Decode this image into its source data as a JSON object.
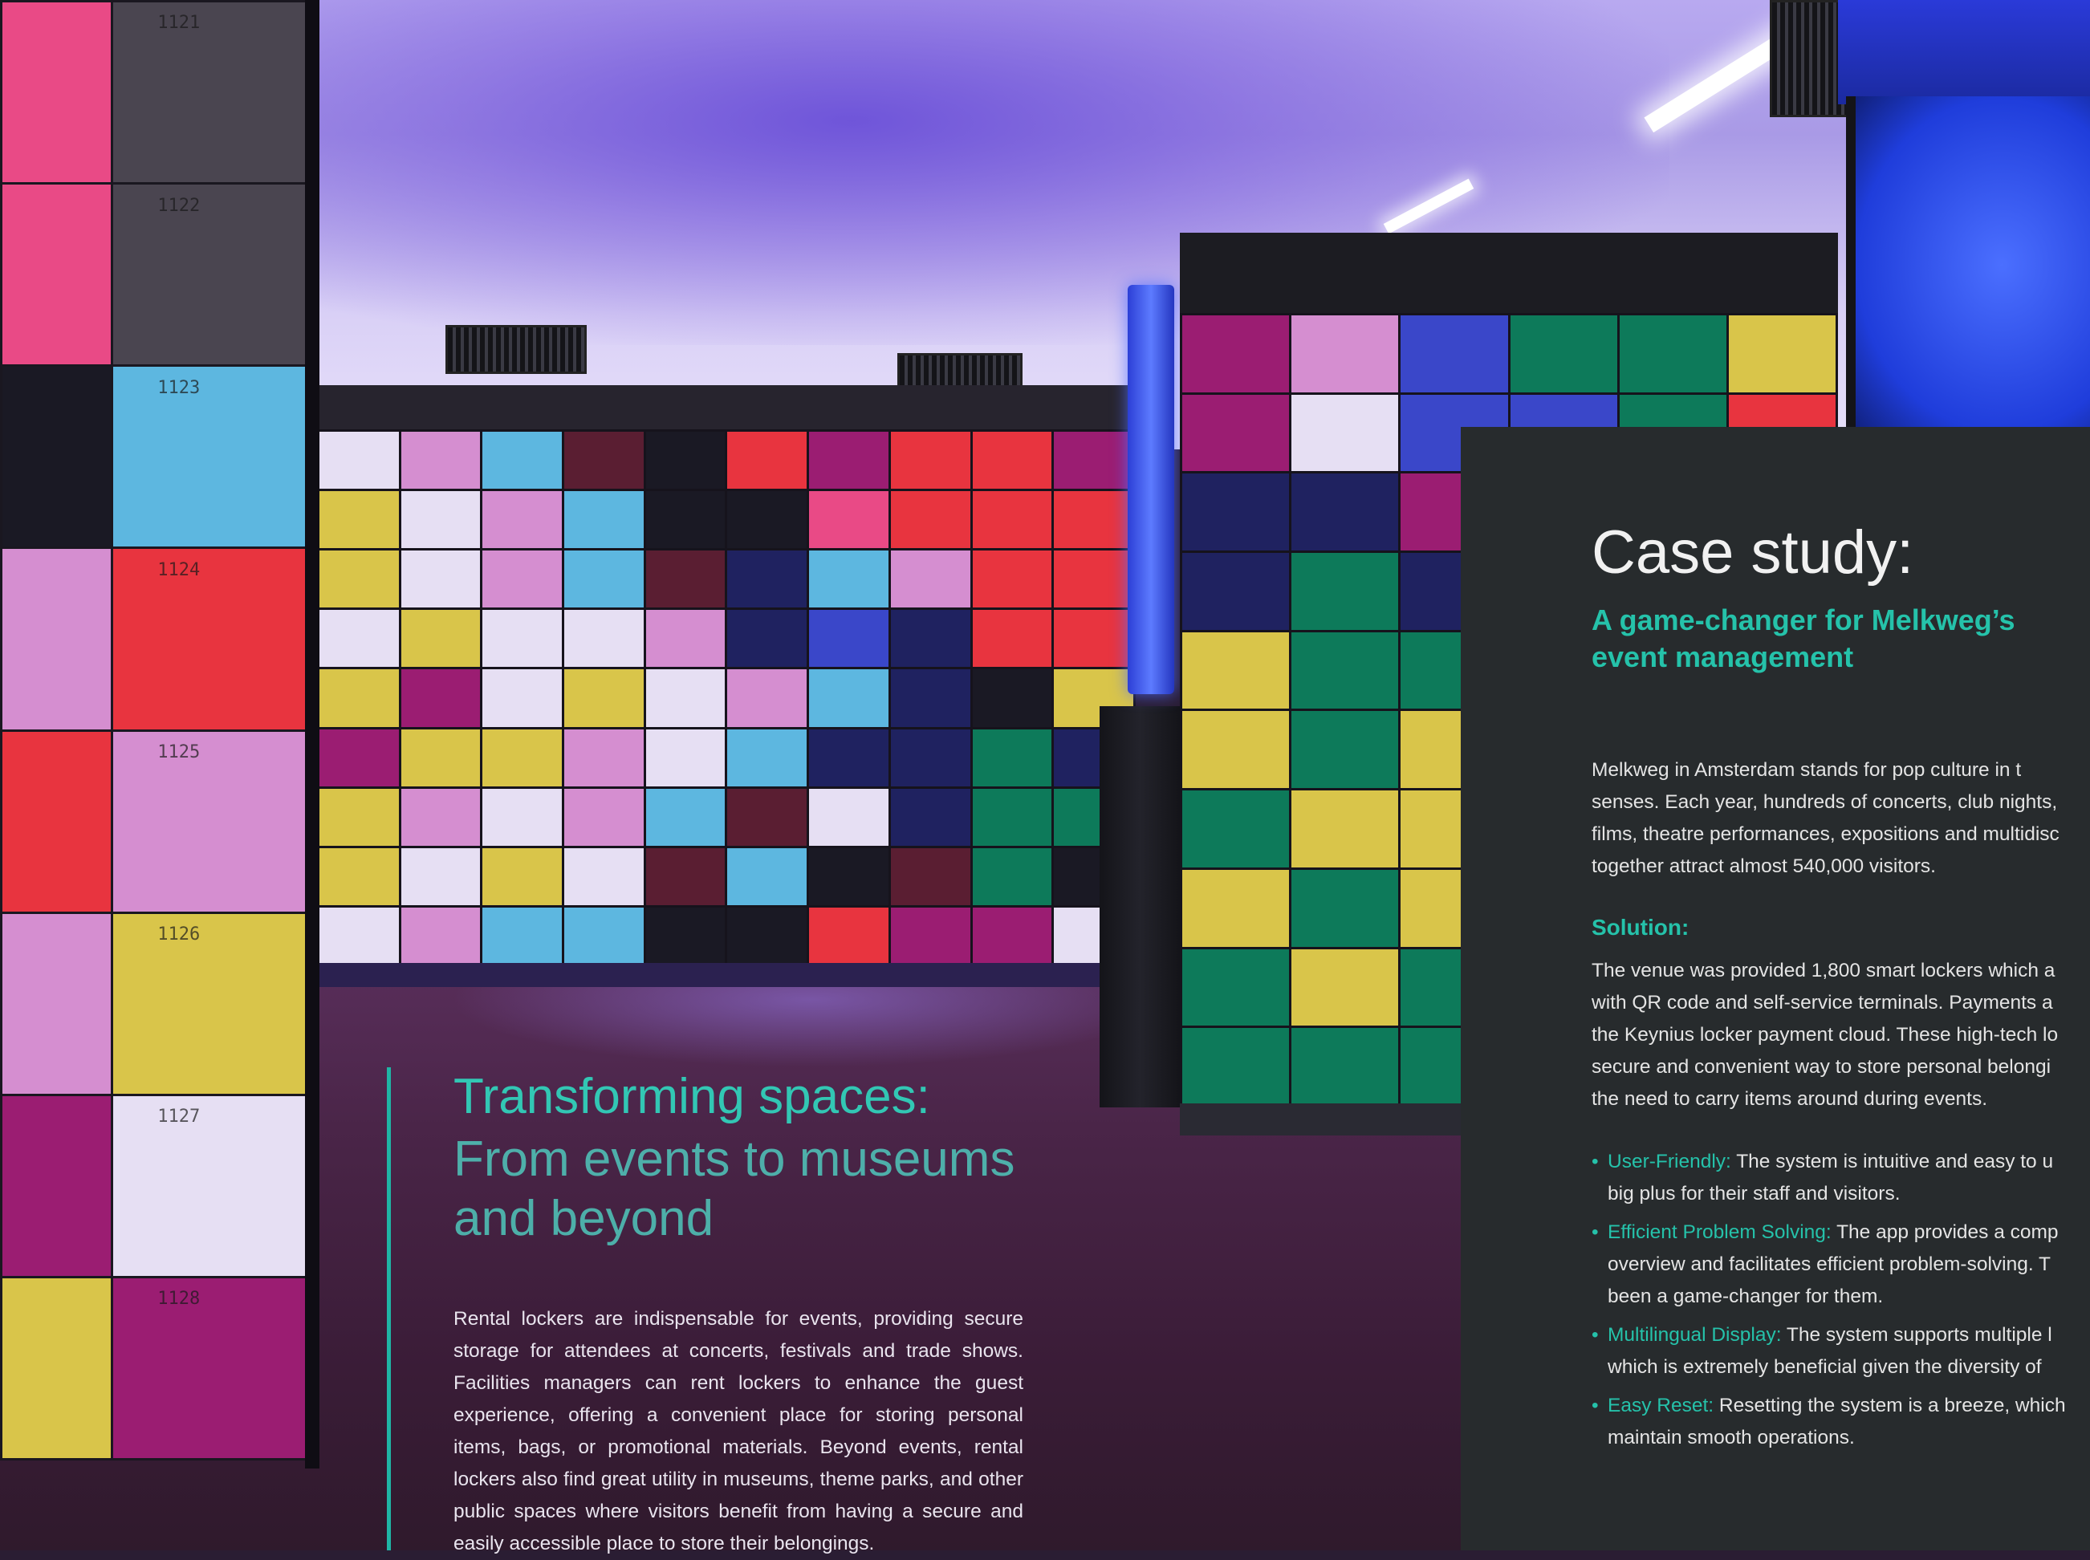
{
  "background": {
    "locker_numbers_left": [
      "1121",
      "1122",
      "1123",
      "1124",
      "1125",
      "1126",
      "1127",
      "1128"
    ],
    "locker_colors": {
      "pink": "#e94a86",
      "magenta": "#9b1d72",
      "red": "#e8343f",
      "yellow": "#d9c54a",
      "lightblue": "#5db7e0",
      "lavender": "#e6dff3",
      "violet": "#d58ed0",
      "navy": "#1f2260",
      "green": "#0d7a5a",
      "black": "#1a1924",
      "grey": "#4a4550",
      "blue": "#3a47c9",
      "maroon": "#5a1e32"
    }
  },
  "left_section": {
    "heading": "Transforming spaces:",
    "subheading": "From events to museums and beyond",
    "body": "Rental lockers are indispensable for events, providing secure storage for attendees at concerts, festivals and trade shows. Facilities managers can rent lockers to enhance the guest experience, offering a convenient place for storing personal items, bags, or promotional materials. Beyond events, rental lockers also find great utility in museums, theme parks, and other public spaces where visitors benefit from having a secure and easily accessible place to store their belongings."
  },
  "case_study": {
    "title": "Case study:",
    "subtitle": "A game-changer for Melkweg’s event management",
    "intro": "Melkweg in Amsterdam stands for pop culture in t\nsenses. Each year, hundreds of concerts, club nights,\nfilms, theatre performances, expositions and multidisc\ntogether attract almost 540,000 visitors.",
    "solution_heading": "Solution:",
    "solution_text": "The venue was provided 1,800 smart lockers which a\nwith QR code and self-service terminals. Payments a\nthe Keynius locker payment cloud. These high-tech lo\nsecure and convenient way to store personal belongi\nthe need to carry items around during events.",
    "features": [
      {
        "label": "User-Friendly:",
        "text": " The system is intuitive and easy to u\nbig plus for their staff and visitors."
      },
      {
        "label": "Efficient Problem Solving:",
        "text": " The app provides a comp\noverview and facilitates efficient problem-solving. T\nbeen a game-changer for them."
      },
      {
        "label": "Multilingual Display:",
        "text": " The system supports multiple l\nwhich is extremely beneficial given the diversity of"
      },
      {
        "label": "Easy Reset:",
        "text": " Resetting the system is a breeze, which\nmaintain smooth operations."
      }
    ],
    "bullet_char": "•",
    "accent_color": "#25c2aa"
  }
}
